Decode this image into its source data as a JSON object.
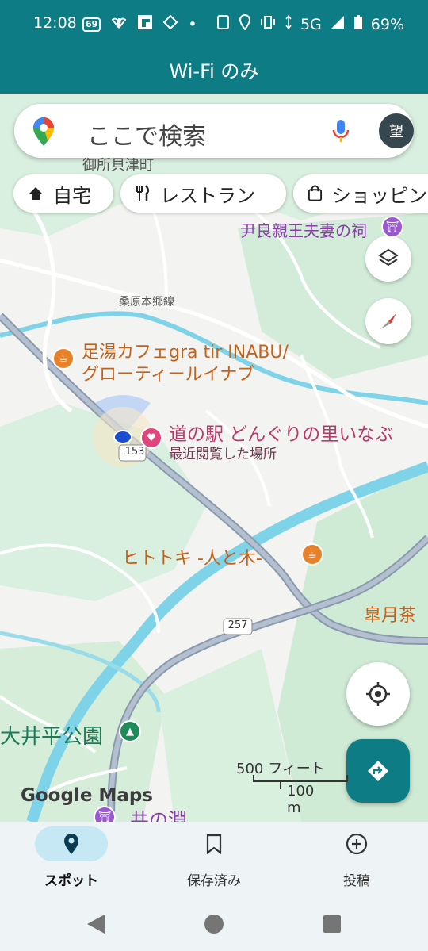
{
  "status": {
    "time": "12:08",
    "notif_badge": "69",
    "network": "5G",
    "battery": "69%"
  },
  "header": {
    "title": "Wi-Fi のみ"
  },
  "search": {
    "placeholder": "ここで検索",
    "avatar_letter": "望"
  },
  "chips": [
    {
      "label": "自宅",
      "icon": "home-icon"
    },
    {
      "label": "レストラン",
      "icon": "restaurant-icon"
    },
    {
      "label": "ショッピン",
      "icon": "shopping-bag-icon"
    }
  ],
  "map": {
    "labels": {
      "town": "御所貝津町",
      "shrine": "尹良親王夫妻の祠",
      "rail": "桑原本郷線",
      "cafe_line1": "足湯カフェgra tir INABU/",
      "cafe_line2": "グローティールイナブ",
      "station_name": "道の駅 どんぐりの里いなぶ",
      "station_sub": "最近閲覧した場所",
      "route153": "153",
      "hitotoki": "ヒトトキ -人と木-",
      "satsuki": "皐月茶",
      "route257": "257",
      "park": "大井平公園",
      "bottom_poi": "井の淵"
    },
    "scale_ft": "500 フィート",
    "scale_m": "100 m",
    "brand": "Google Maps"
  },
  "bottom_nav": [
    {
      "label": "スポット",
      "icon": "location-pin-icon",
      "active": true
    },
    {
      "label": "保存済み",
      "icon": "bookmark-icon",
      "active": false
    },
    {
      "label": "投稿",
      "icon": "add-circle-icon",
      "active": false
    }
  ],
  "colors": {
    "header": "#0e7c85",
    "accent": "#0e7c85",
    "active_pill": "#c5e8f4"
  }
}
